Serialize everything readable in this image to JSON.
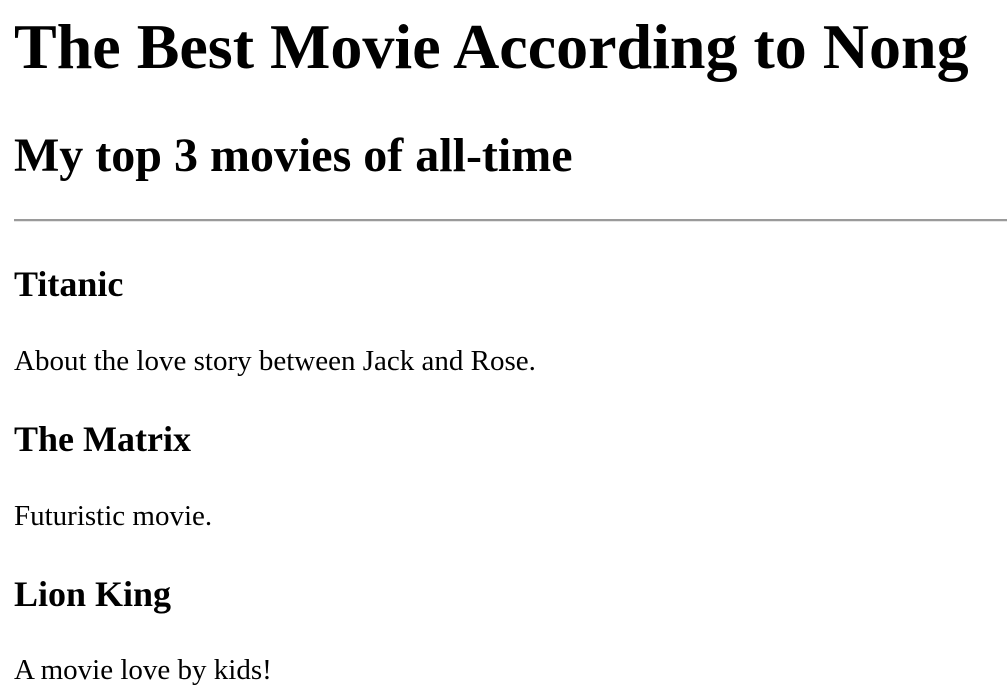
{
  "header": {
    "title": "The Best Movie According to Nong",
    "subtitle": "My top 3 movies of all-time"
  },
  "movies": [
    {
      "title": "Titanic",
      "description": "About the love story between Jack and Rose."
    },
    {
      "title": "The Matrix",
      "description": "Futuristic movie."
    },
    {
      "title": "Lion King",
      "description": "A movie love by kids!"
    }
  ]
}
